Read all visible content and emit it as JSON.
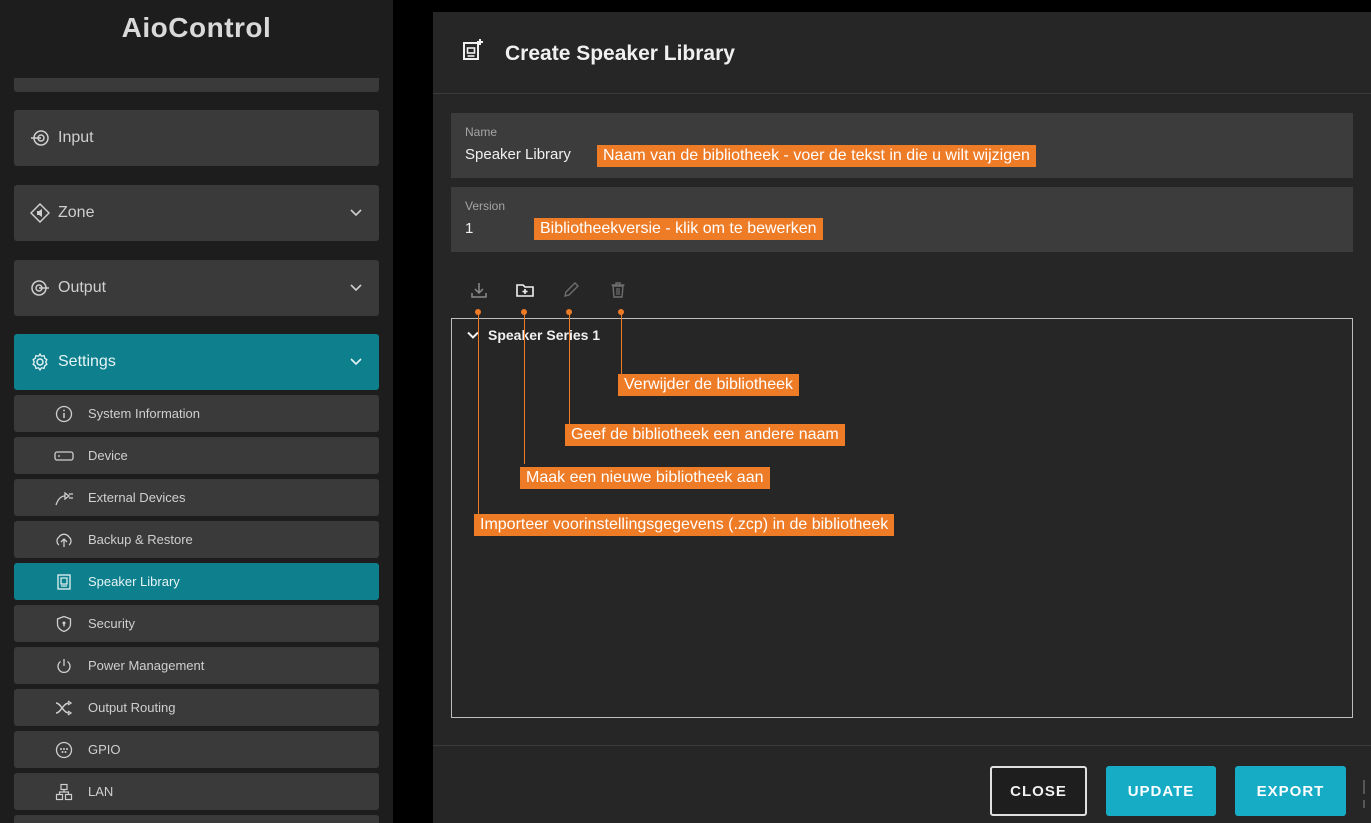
{
  "app": {
    "brand": "AioControl"
  },
  "sidebar": {
    "groups": [
      {
        "label": "Input",
        "icon": "input-icon"
      },
      {
        "label": "Zone",
        "icon": "zone-icon"
      },
      {
        "label": "Output",
        "icon": "output-icon"
      },
      {
        "label": "Settings",
        "icon": "settings-icon",
        "expanded": true
      }
    ],
    "items": [
      {
        "label": "System Information",
        "icon": "info-icon"
      },
      {
        "label": "Device",
        "icon": "device-icon"
      },
      {
        "label": "External Devices",
        "icon": "external-devices-icon"
      },
      {
        "label": "Backup & Restore",
        "icon": "backup-icon"
      },
      {
        "label": "Speaker Library",
        "icon": "speaker-library-icon",
        "active": true
      },
      {
        "label": "Security",
        "icon": "shield-icon"
      },
      {
        "label": "Power Management",
        "icon": "power-icon"
      },
      {
        "label": "Output Routing",
        "icon": "routing-icon"
      },
      {
        "label": "GPIO",
        "icon": "gpio-icon"
      },
      {
        "label": "LAN",
        "icon": "lan-icon"
      }
    ]
  },
  "dialog": {
    "title": "Create Speaker Library",
    "name_label": "Name",
    "name_value": "Speaker Library",
    "version_label": "Version",
    "version_value": "1",
    "toolbar": [
      "import-icon",
      "new-folder-icon",
      "rename-icon",
      "delete-icon"
    ],
    "tree": {
      "node_label": "Speaker Series 1"
    },
    "buttons": {
      "close": "CLOSE",
      "update": "UPDATE",
      "export": "EXPORT"
    }
  },
  "annotations": {
    "name_hint": "Naam van de bibliotheek - voer de tekst in die u wilt wijzigen",
    "version_hint": "Bibliotheekversie - klik om te bewerken",
    "delete_hint": "Verwijder de bibliotheek",
    "rename_hint": "Geef de bibliotheek een andere naam",
    "new_hint": "Maak een nieuwe bibliotheek aan",
    "import_hint": "Importeer voorinstellingsgegevens (.zcp) in de bibliotheek"
  },
  "colors": {
    "accent_teal": "#0d7f8d",
    "button_cyan": "#17acc6",
    "annotation_orange": "#ee7b26"
  }
}
